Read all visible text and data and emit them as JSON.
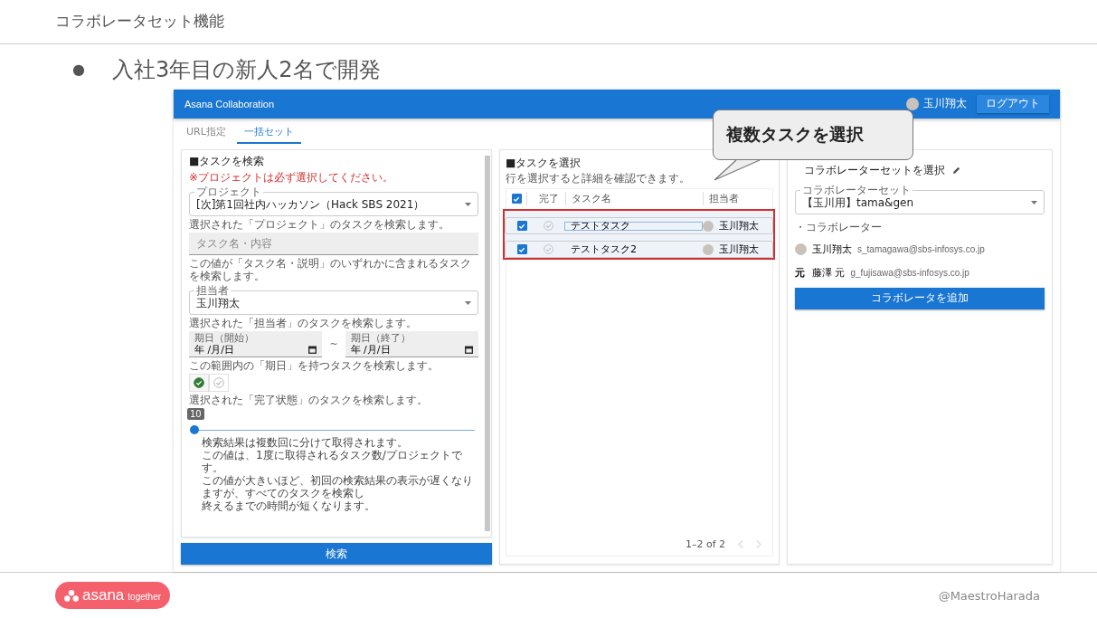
{
  "slide": {
    "title": "コラボレータセット機能",
    "bullet_mark": "●",
    "bullet": "入社3年目の新人2名で開発"
  },
  "app": {
    "title": "Asana Collaboration",
    "user": "玉川翔太",
    "logout": "ログアウト",
    "tabs": [
      {
        "label": "URL指定",
        "selected": false
      },
      {
        "label": "一括セット",
        "selected": true
      }
    ]
  },
  "search": {
    "heading": "■タスクを検索",
    "required_note": "※プロジェクトは必ず選択してください。",
    "project": {
      "label": "プロジェクト",
      "value": "[次]第1回社内ハッカソン（Hack SBS 2021）",
      "hint": "選択された「プロジェクト」のタスクを検索します。"
    },
    "keyword": {
      "placeholder": "タスク名・内容",
      "hint": "この値が「タスク名・説明」のいずれかに含まれるタスクを検索します。"
    },
    "assignee": {
      "label": "担当者",
      "value": "玉川翔太",
      "hint": "選択された「担当者」のタスクを検索します。"
    },
    "due_start": {
      "label": "期日（開始）",
      "value": "年 /月/日"
    },
    "separator": "~",
    "due_end": {
      "label": "期日（終了）",
      "value": "年 /月/日"
    },
    "due_hint": "この範囲内の「期日」を持つタスクを検索します。",
    "status_toggles": [
      {
        "selected": true
      },
      {
        "selected": false
      }
    ],
    "status_hint": "選択された「完了状態」のタスクを検索します。",
    "slider": {
      "reading": "10",
      "level": 0
    },
    "notes": [
      "検索結果は複数回に分けて取得されます。",
      "この値は、1度に取得されるタスク数/プロジェクトです。",
      "この値が大きいほど、初回の検索結果の表示が遅くなりますが、すべてのタスクを検索し",
      "終えるまでの時間が短くなります。"
    ],
    "button": "検索"
  },
  "tasks": {
    "heading": "■タスクを選択",
    "hint": "行を選択すると詳細を確認できます。",
    "all_checked": true,
    "columns": [
      "完了",
      "タスク名",
      "担当者"
    ],
    "rows": [
      {
        "checked": true,
        "done": false,
        "focused": true,
        "name": "テストタスク",
        "assignee": "玉川翔太"
      },
      {
        "checked": true,
        "done": false,
        "focused": false,
        "name": "テストタスク2",
        "assignee": "玉川翔太"
      }
    ],
    "pagination": "1–2 of 2"
  },
  "collab": {
    "heading": "コラボレーターセットを選択",
    "set": {
      "label": "コラボレーターセット",
      "value": "【玉川用】tama&gen"
    },
    "list_label": "・コラボレーター",
    "members": [
      {
        "name": "玉川翔太",
        "email": "s_tamagawa@sbs-infosys.co.jp"
      },
      {
        "avatar_text": "元",
        "name": "藤澤 元",
        "email": "g_fujisawa@sbs-infosys.co.jp"
      }
    ],
    "button": "コラボレータを追加"
  },
  "callout": {
    "text": "複数タスクを選択"
  },
  "footer": {
    "logo": "asana",
    "logo_tagline": "together",
    "handle": "@MaestroHarada"
  }
}
